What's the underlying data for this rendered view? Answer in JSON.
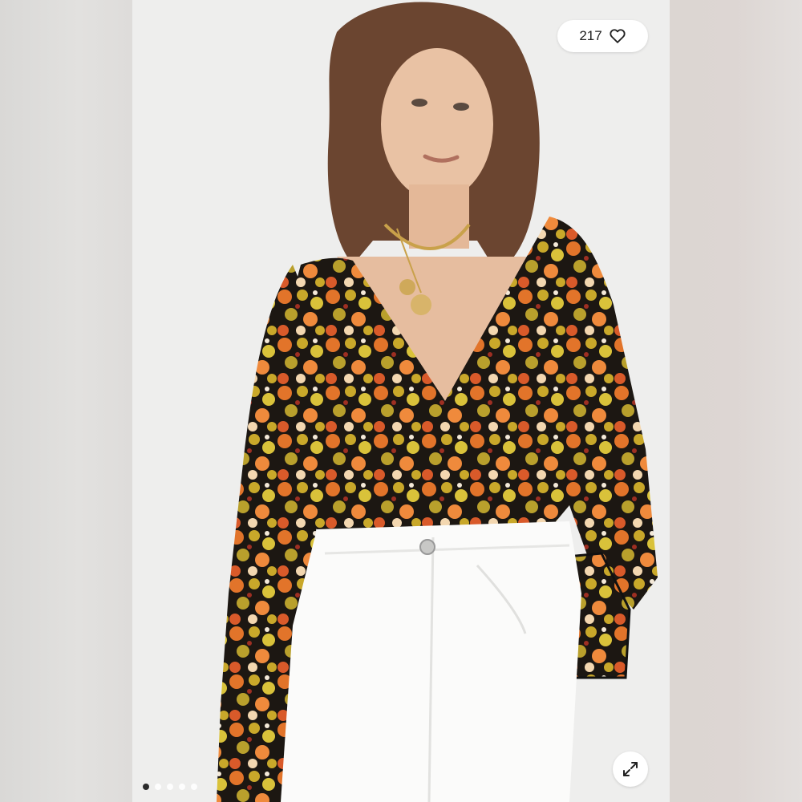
{
  "listing": {
    "likes_count": "217",
    "heart_icon": "heart-outline-icon",
    "expand_icon": "expand-arrows-icon"
  },
  "carousel": {
    "total_slides": 5,
    "active_index": 0
  },
  "colors": {
    "background": "#e9e8e6",
    "pill": "#ffffff",
    "print_orange": "#e2742a",
    "print_mustard": "#c9a82a",
    "print_black": "#1c1712"
  }
}
